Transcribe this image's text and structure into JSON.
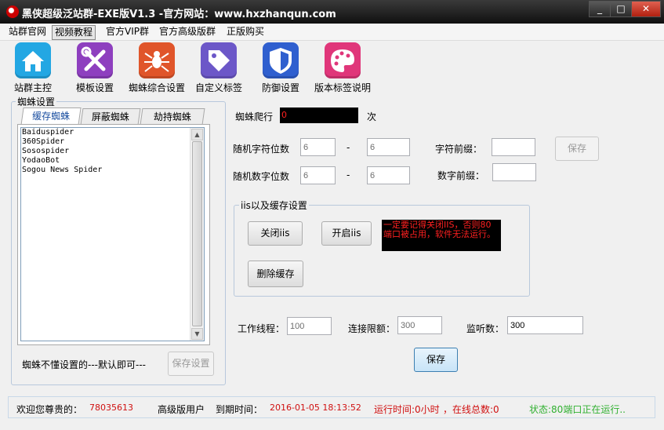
{
  "window": {
    "title": "黑侠超级泛站群-EXE版V1.3 -官方网站：www.hxzhanqun.com",
    "controls": {
      "minimize": "_",
      "maximize": "□",
      "close": "✕"
    }
  },
  "menu": {
    "items": [
      "站群官网",
      "视频教程",
      "官方VIP群",
      "官方高级版群",
      "正版购买"
    ],
    "active_index": 1
  },
  "toolbar": {
    "items": [
      {
        "label": "站群主控",
        "icon": "home-icon",
        "color": "#23a7e3"
      },
      {
        "label": "模板设置",
        "icon": "tools-icon",
        "color": "#8e3fbf"
      },
      {
        "label": "蜘蛛综合设置",
        "icon": "spider-icon",
        "color": "#e0552a"
      },
      {
        "label": "自定义标签",
        "icon": "tag-icon",
        "color": "#6c57c8"
      },
      {
        "label": "防御设置",
        "icon": "shield-icon",
        "color": "#2f5fcf"
      },
      {
        "label": "版本标签说明",
        "icon": "palette-icon",
        "color": "#e0367a"
      }
    ]
  },
  "spider_settings": {
    "title": "蜘蛛设置",
    "tabs": [
      "缓存蜘蛛",
      "屏蔽蜘蛛",
      "劫持蜘蛛"
    ],
    "active_tab": 0,
    "list": [
      "Baiduspider",
      "360Spider",
      "Sosospider",
      "YodaoBot",
      "Sogou News Spider"
    ],
    "hint": "蜘蛛不懂设置的---默认即可---",
    "save_button": "保存设置"
  },
  "crawl": {
    "label": "蜘蛛爬行",
    "value": "0",
    "unit": "次"
  },
  "random_chars": {
    "label": "随机字符位数",
    "min": "6",
    "sep": "-",
    "max": "6",
    "prefix_label": "字符前缀：",
    "prefix_value": ""
  },
  "random_digits": {
    "label": "随机数字位数",
    "min": "6",
    "sep": "-",
    "max": "6",
    "prefix_label": "数字前缀：",
    "prefix_value": ""
  },
  "save_top": "保存",
  "iis": {
    "title": "iis以及缓存设置",
    "close_btn": "关闭iis",
    "open_btn": "开启iis",
    "clear_btn": "删除缓存",
    "warning": "一定要记得关闭IIS，否则80端口被占用，软件无法运行。"
  },
  "threads": {
    "work_label": "工作线程：",
    "work_value": "100",
    "conn_label": "连接限额：",
    "conn_value": "300",
    "listen_label": "监听数：",
    "listen_value": "300"
  },
  "save_bottom": "保存",
  "status": {
    "welcome": "欢迎您尊贵的：",
    "user_id": "78035613",
    "user_type": "高级版用户",
    "expire_label": "到期时间：",
    "expire_value": "2016-01-05 18:13:52",
    "runtime": "运行时间:0小时",
    "online": "，在线总数:0",
    "state": "状态:80端口正在运行..",
    "colors": {
      "value": "#d01010",
      "state": "#30b030"
    }
  }
}
